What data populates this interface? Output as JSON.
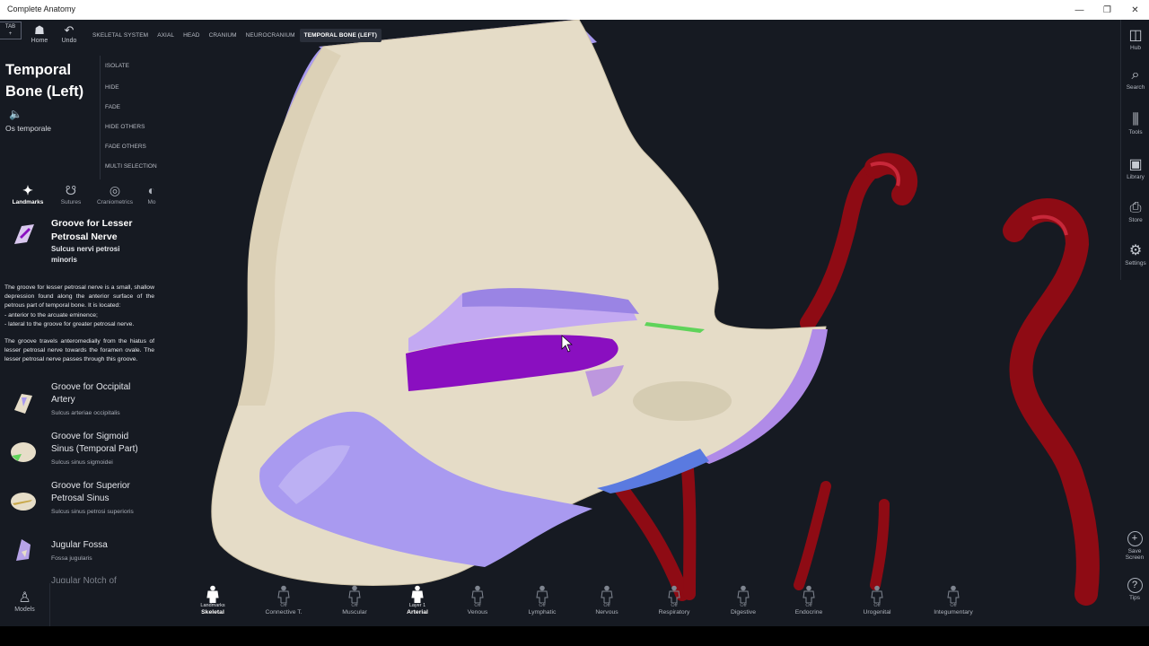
{
  "window": {
    "title": "Complete Anatomy",
    "minimize_glyph": "—",
    "restore_glyph": "❐",
    "close_glyph": "✕"
  },
  "topnav": {
    "tab_label": "TAB",
    "tab_plus": "+",
    "home_label": "Home",
    "undo_label": "Undo",
    "breadcrumb": [
      "SKELETAL SYSTEM",
      "AXIAL",
      "HEAD",
      "CRANIUM",
      "NEUROCRANIUM",
      "TEMPORAL BONE (LEFT)"
    ]
  },
  "structure": {
    "title": "Temporal Bone (Left)",
    "latin": "Os temporale",
    "actions": [
      "ISOLATE",
      "HIDE",
      "FADE",
      "HIDE OTHERS",
      "FADE OTHERS",
      "MULTI SELECTION"
    ]
  },
  "panel_tabs": [
    {
      "label": "Landmarks",
      "icon": "bone-icon",
      "active": true
    },
    {
      "label": "Sutures",
      "icon": "skull-icon",
      "active": false
    },
    {
      "label": "Craniometrics",
      "icon": "measure-icon",
      "active": false
    },
    {
      "label": "Mo",
      "icon": "more-icon",
      "active": false
    }
  ],
  "landmark": {
    "name": "Groove for Lesser Petrosal Nerve",
    "latin": "Sulcus nervi petrosi minoris",
    "description_1": "The groove for lesser petrosal nerve is a small, shallow depression found along the anterior surface of the petrous part of temporal bone. It is located:",
    "bullet_1": "- anterior to the arcuate eminence;",
    "bullet_2": "- lateral to the groove for greater petrosal nerve.",
    "description_2": "The groove travels anteromedially from the hiatus of lesser petrosal nerve towards the foramen ovale. The lesser petrosal nerve passes through this groove."
  },
  "landmark_list": [
    {
      "name": "Groove for Occipital Artery",
      "latin": "Sulcus arteriae occipitalis"
    },
    {
      "name": "Groove for Sigmoid Sinus (Temporal Part)",
      "latin": "Sulcus sinus sigmoidei"
    },
    {
      "name": "Groove for Superior Petrosal Sinus",
      "latin": "Sulcus sinus petrosi superioris"
    },
    {
      "name": "Jugular Fossa",
      "latin": "Fossa jugularis"
    }
  ],
  "landmark_list_partial": "Jugular Notch of",
  "right_toolbar": [
    {
      "label": "Hub",
      "icon": "hub-icon"
    },
    {
      "label": "Search",
      "icon": "search-icon"
    },
    {
      "label": "Tools",
      "icon": "tools-icon"
    },
    {
      "label": "Library",
      "icon": "library-icon"
    },
    {
      "label": "Store",
      "icon": "store-icon"
    },
    {
      "label": "Settings",
      "icon": "settings-icon"
    }
  ],
  "save_screen_label": "Save Screen",
  "tips_label": "Tips",
  "models_label": "Models",
  "systems": [
    {
      "layer": "Landmarks",
      "name": "Skeletal",
      "on": true
    },
    {
      "layer": "Off",
      "name": "Connective T.",
      "on": false
    },
    {
      "layer": "Off",
      "name": "Muscular",
      "on": false
    },
    {
      "layer": "Layer 1",
      "name": "Arterial",
      "on": true
    },
    {
      "layer": "Off",
      "name": "Venous",
      "on": false
    },
    {
      "layer": "Off",
      "name": "Lymphatic",
      "on": false
    },
    {
      "layer": "Off",
      "name": "Nervous",
      "on": false
    },
    {
      "layer": "Off",
      "name": "Respiratory",
      "on": false
    },
    {
      "layer": "Off",
      "name": "Digestive",
      "on": false
    },
    {
      "layer": "Off",
      "name": "Endocrine",
      "on": false
    },
    {
      "layer": "Off",
      "name": "Urogenital",
      "on": false
    },
    {
      "layer": "Off",
      "name": "Integumentary",
      "on": false
    }
  ],
  "colors": {
    "background": "#161a22",
    "bone": "#e5dcc7",
    "highlight": "#8a0fc0",
    "landmark_lavender": "#a99af0",
    "artery": "#8e0b14"
  }
}
